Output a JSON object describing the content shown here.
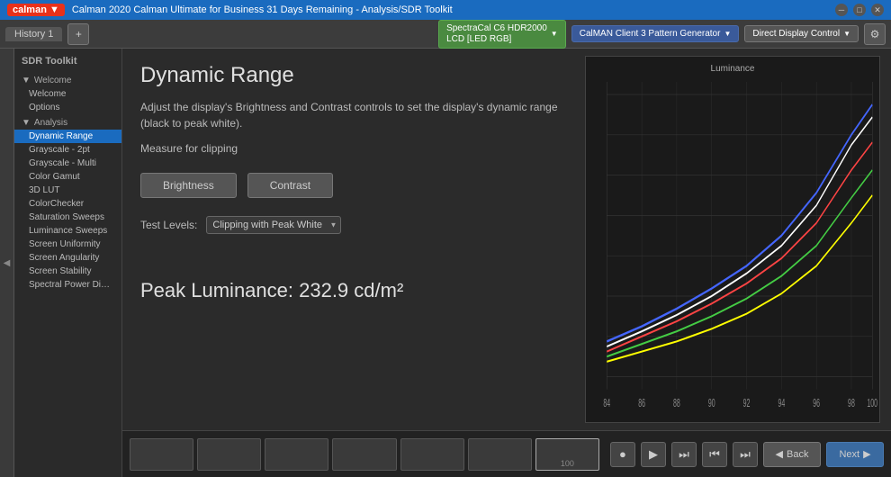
{
  "titlebar": {
    "logo": "calman",
    "title": "Calman 2020 Calman Ultimate for Business 31 Days Remaining  -  Analysis/SDR Toolkit"
  },
  "toolbar": {
    "history_tab": "History 1",
    "device1": {
      "label": "SpectraCal C6 HDR2000\nLCD [LED RGB]",
      "color": "green"
    },
    "device2": {
      "label": "CalMAN Client 3 Pattern Generator",
      "color": "blue"
    },
    "device3": {
      "label": "Direct Display Control",
      "color": "gray"
    }
  },
  "sidebar": {
    "title": "SDR Toolkit",
    "sections": [
      {
        "label": "Welcome",
        "items": []
      },
      {
        "label": "Welcome",
        "items": [
          "Welcome",
          "Options"
        ]
      },
      {
        "label": "Analysis",
        "items": [
          "Dynamic Range",
          "Grayscale - 2pt",
          "Grayscale - Multi",
          "Color Gamut",
          "3D LUT",
          "ColorChecker",
          "Saturation Sweeps",
          "Luminance Sweeps",
          "Screen Uniformity",
          "Screen Angularity",
          "Screen Stability",
          "Spectral Power Dist..."
        ]
      }
    ]
  },
  "content": {
    "page_title": "Dynamic Range",
    "description": "Adjust the display's Brightness and Contrast controls to set the display's dynamic range (black to peak white).",
    "measure_text": "Measure for clipping",
    "buttons": {
      "brightness": "Brightness",
      "contrast": "Contrast"
    },
    "test_levels_label": "Test Levels:",
    "test_levels_value": "Clipping with Peak White",
    "peak_luminance_label": "Peak Luminance: 232.9  cd/m²"
  },
  "chart": {
    "title": "Luminance",
    "x_labels": [
      "84",
      "86",
      "88",
      "90",
      "92",
      "94",
      "96",
      "98",
      "100"
    ],
    "colors": {
      "white": "#ffffff",
      "red": "#ff4444",
      "green": "#44ff44",
      "blue": "#4444ff",
      "yellow": "#ffff00"
    }
  },
  "bottom_strip": {
    "swatches": [
      {
        "label": "",
        "value": ""
      },
      {
        "label": "",
        "value": ""
      },
      {
        "label": "",
        "value": ""
      },
      {
        "label": "",
        "value": ""
      },
      {
        "label": "",
        "value": ""
      },
      {
        "label": "",
        "value": ""
      },
      {
        "label": "100",
        "value": "100",
        "active": true
      }
    ],
    "nav": {
      "back_label": "Back",
      "next_label": "Next"
    }
  },
  "icons": {
    "chevron_left": "◀",
    "chevron_right": "▶",
    "settings": "⚙",
    "record": "●",
    "play": "▶",
    "skip": "⏭",
    "rewind": "⏮",
    "forward": "⏭"
  }
}
